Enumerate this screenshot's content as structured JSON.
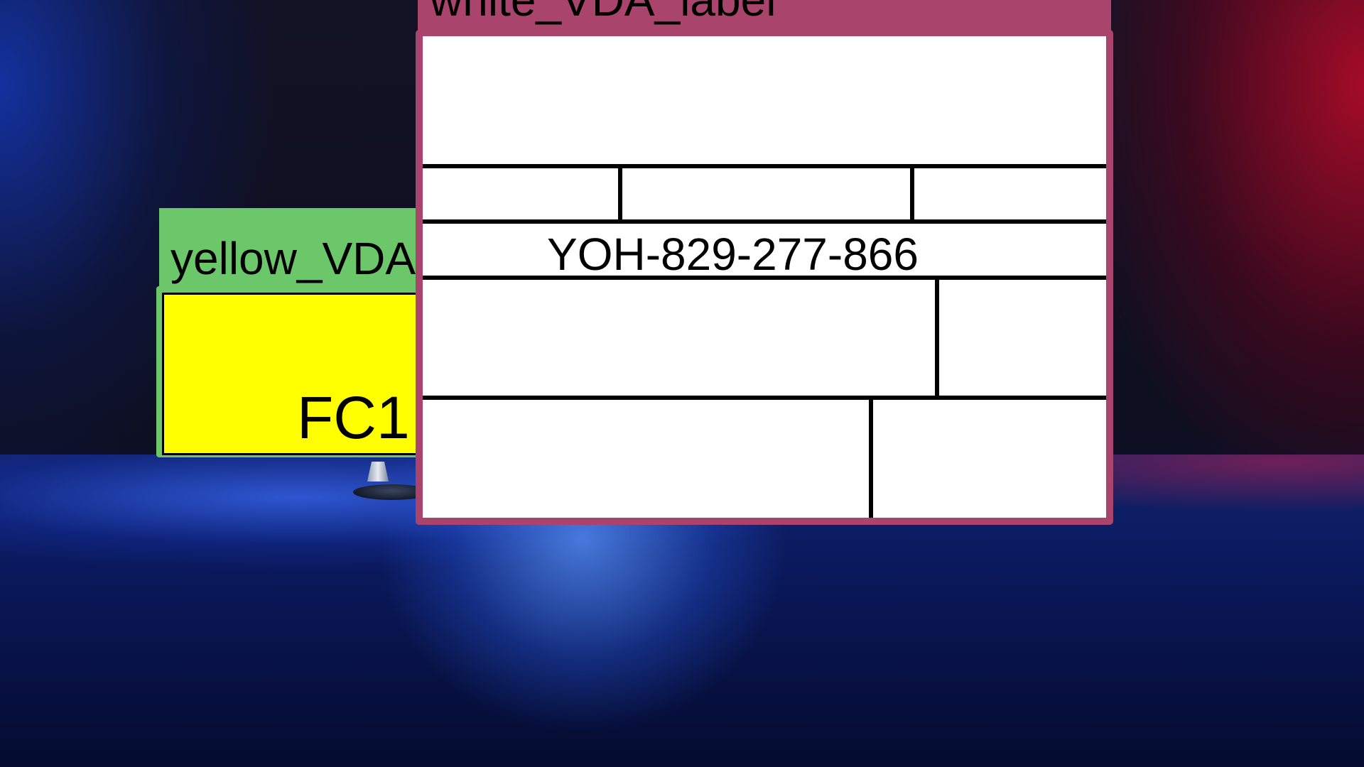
{
  "windows": {
    "yellow": {
      "title": "yellow_VDA",
      "body_text": "FC1",
      "titlebar_color": "#6cc76a",
      "body_color": "#ffff00"
    },
    "white": {
      "title": "white_VDA_label",
      "code": "YOH-829-277-866",
      "titlebar_color": "#a9456d",
      "body_color": "#ffffff"
    }
  },
  "background": {
    "description_colors": {
      "left_glow": "#1438c8",
      "right_glow": "#be0a28",
      "floor": "#1e3ca0"
    }
  }
}
